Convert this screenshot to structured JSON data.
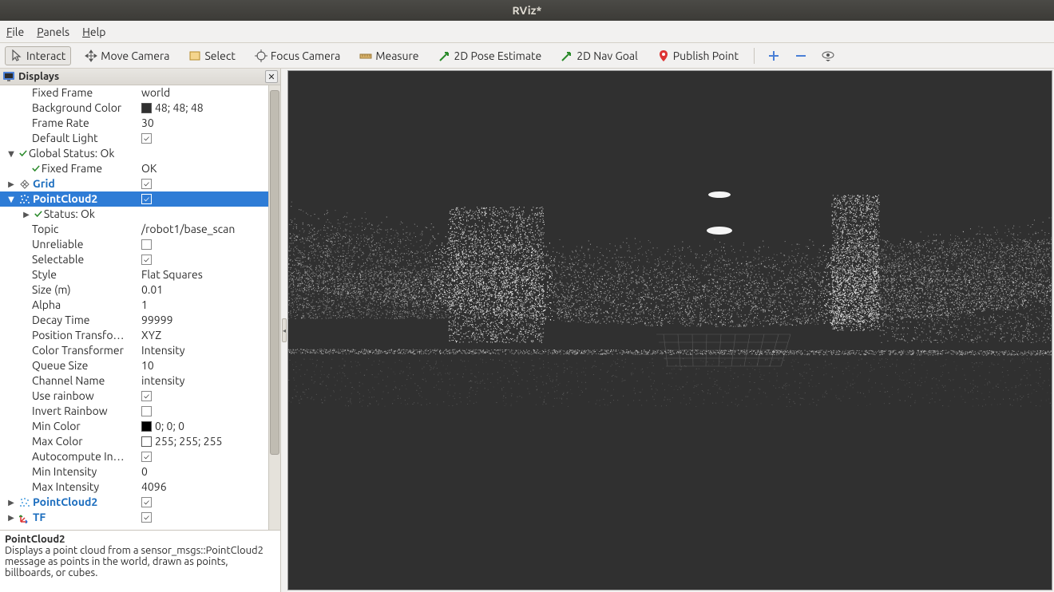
{
  "window": {
    "title": "RViz*"
  },
  "menubar": [
    {
      "label": "File",
      "u": 0
    },
    {
      "label": "Panels",
      "u": 0
    },
    {
      "label": "Help",
      "u": 0
    }
  ],
  "toolbar": {
    "interact": "Interact",
    "move_camera": "Move Camera",
    "select": "Select",
    "focus_camera": "Focus Camera",
    "measure": "Measure",
    "pose_estimate": "2D Pose Estimate",
    "nav_goal": "2D Nav Goal",
    "publish_point": "Publish Point"
  },
  "displays": {
    "panel_title": "Displays",
    "global": {
      "fixed_frame": {
        "label": "Fixed Frame",
        "value": "world"
      },
      "background_color": {
        "label": "Background Color",
        "value": "48; 48; 48",
        "swatch": "#303030"
      },
      "frame_rate": {
        "label": "Frame Rate",
        "value": "30"
      },
      "default_light": {
        "label": "Default Light",
        "checked": true
      },
      "global_status": {
        "label": "Global Status: Ok"
      },
      "fixed_frame_status": {
        "label": "Fixed Frame",
        "value": "OK"
      },
      "grid": {
        "label": "Grid",
        "checked": true
      }
    },
    "pointcloud2": {
      "label": "PointCloud2",
      "checked": true,
      "status": {
        "label": "Status: Ok"
      },
      "topic": {
        "label": "Topic",
        "value": "/robot1/base_scan"
      },
      "unreliable": {
        "label": "Unreliable",
        "checked": false
      },
      "selectable": {
        "label": "Selectable",
        "checked": true
      },
      "style": {
        "label": "Style",
        "value": "Flat Squares"
      },
      "size": {
        "label": "Size (m)",
        "value": "0.01"
      },
      "alpha": {
        "label": "Alpha",
        "value": "1"
      },
      "decay_time": {
        "label": "Decay Time",
        "value": "99999"
      },
      "position_transformer": {
        "label": "Position Transfo…",
        "value": "XYZ"
      },
      "color_transformer": {
        "label": "Color Transformer",
        "value": "Intensity"
      },
      "queue_size": {
        "label": "Queue Size",
        "value": "10"
      },
      "channel_name": {
        "label": "Channel Name",
        "value": "intensity"
      },
      "use_rainbow": {
        "label": "Use rainbow",
        "checked": true
      },
      "invert_rainbow": {
        "label": "Invert Rainbow",
        "checked": false
      },
      "min_color": {
        "label": "Min Color",
        "value": "0; 0; 0",
        "swatch": "#000000"
      },
      "max_color": {
        "label": "Max Color",
        "value": "255; 255; 255",
        "swatch": "#ffffff"
      },
      "autocompute": {
        "label": "Autocompute In…",
        "checked": true
      },
      "min_intensity": {
        "label": "Min Intensity",
        "value": "0"
      },
      "max_intensity": {
        "label": "Max Intensity",
        "value": "4096"
      }
    },
    "pointcloud2_2": {
      "label": "PointCloud2",
      "checked": true
    },
    "tf": {
      "label": "TF",
      "checked": true
    }
  },
  "description": {
    "title": "PointCloud2",
    "body": "Displays a point cloud from a sensor_msgs::PointCloud2 message as points in the world, drawn as points, billboards, or cubes."
  }
}
